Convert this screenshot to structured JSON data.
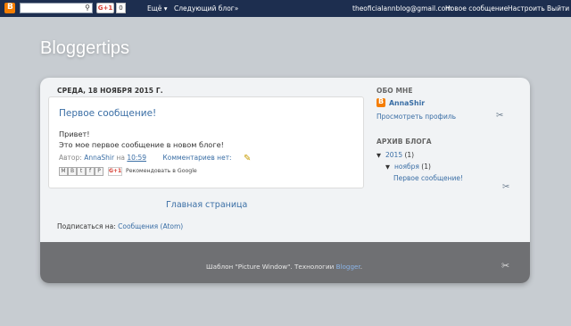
{
  "navbar": {
    "gplus_label": "G+1",
    "gplus_count": "0",
    "more_label": "Ещё ▾",
    "next_blog_label": "Следующий блог»",
    "email": "theoficialannblog@gmail.com",
    "new_post_label": "Новое сообщение",
    "settings_label": "Настроить",
    "exit_label": "Выйти"
  },
  "blog": {
    "title": "Bloggertips"
  },
  "post": {
    "date_header": "СРЕДА, 18 НОЯБРЯ 2015 Г.",
    "title": "Первое сообщение!",
    "body_line1": "Привет!",
    "body_line2": "Это мое первое сообщение в новом блоге!",
    "author_prefix": "Автор:",
    "author": "AnnaShir",
    "at": "на",
    "time": "10:59",
    "comments": "Комментариев нет:",
    "share_gplus": "G+1",
    "recommend": "Рекомендовать в Google"
  },
  "main": {
    "home_link": "Главная страница",
    "subscribe_prefix": "Подписаться на:",
    "subscribe_link": "Сообщения (Atom)"
  },
  "sidebar": {
    "about_heading": "ОБО МНЕ",
    "profile_name": "AnnaShir",
    "view_profile": "Просмотреть профиль",
    "archive_heading": "АРХИВ БЛОГА",
    "year": "2015",
    "year_count": "(1)",
    "month": "ноября",
    "month_count": "(1)",
    "archive_post": "Первое сообщение!"
  },
  "footer": {
    "template_text": "Шаблон \"Picture Window\". Технологии",
    "blogger_link": "Blogger",
    "period": "."
  },
  "colors": {
    "navbar_bg": "#1d2e4f",
    "link": "#3a6ea5",
    "footer_bg": "#6f7073",
    "page_bg": "#c7ccd1"
  }
}
